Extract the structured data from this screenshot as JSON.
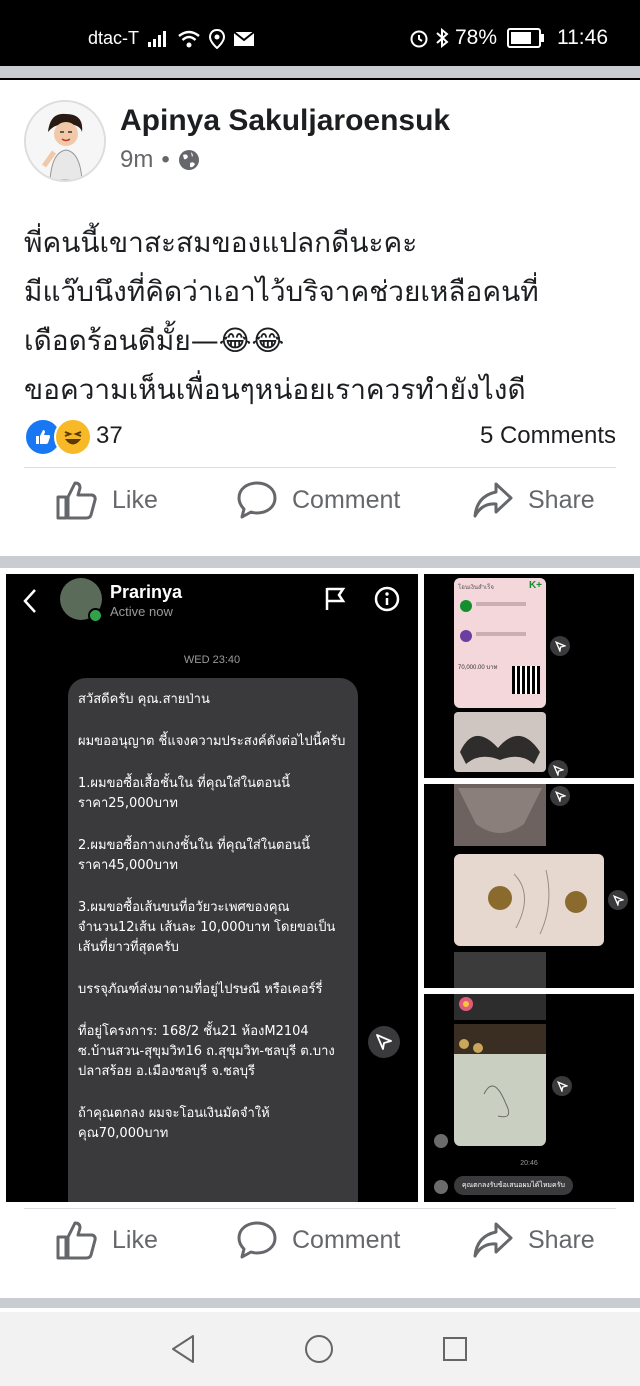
{
  "status_bar": {
    "carrier": "dtac-T",
    "battery": "78%",
    "battery_level": 0.78,
    "time": "11:46"
  },
  "post": {
    "author": "Apinya Sakuljaroensuk",
    "time_ago": "9m",
    "text_lines": [
      "พี่คนนี้เขาสะสมของแปลกดีนะคะ",
      "มีแว๊บนึงที่คิดว่าเอาไว้บริจาคช่วยเหลือคนที่",
      "เดือดร้อนดีมั้ย—😂😂",
      "ขอความเห็นเพื่อนๆหน่อยเราควรทำยังไงดี"
    ],
    "reaction_count": "37",
    "comments": "5 Comments"
  },
  "actions": {
    "like": "Like",
    "comment": "Comment",
    "share": "Share"
  },
  "chat": {
    "contact_name": "Prarinya",
    "contact_status": "Active now",
    "timestamp": "WED 23:40",
    "message_paragraphs": [
      "สวัสดีครับ คุณ.สายป่าน",
      "ผมขออนุญาต ชี้แจงความประสงค์ดังต่อไปนี้ครับ",
      "1.ผมขอซื้อเสื้อชั้นใน ที่คุณใส่ในตอนนี้ ราคา25,000บาท",
      "2.ผมขอซื้อกางเกงชั้นใน ที่คุณใส่ในตอนนี้ ราคา45,000บาท",
      "3.ผมขอซื้อเส้นขนที่อวัยวะเพศของคุณ จำนวน12เส้น เส้นละ 10,000บาท โดยขอเป็นเส้นที่ยาวที่สุดครับ",
      "บรรจุภัณฑ์ส่งมาตามที่อยู่ไปรษณี หรือเคอร์รี่",
      "ที่อยู่โครงการ: 168/2 ชั้น21 ห้องM2104 ซ.บ้านสวน-สุขุมวิท16 ถ.สุขุมวิท-ชลบุรี ต.บางปลาสร้อย อ.เมืองชลบุรี จ.ชลบุรี",
      "ถ้าคุณตกลง ผมจะโอนเงินมัดจำให้คุณ70,000บาท"
    ]
  },
  "thumbnails": {
    "bank_badge": "K+",
    "bank_title": "โอนเงินสำเร็จ",
    "bank_amount": "70,000.00 บาท",
    "small_time": "20:46",
    "small_reply": "คุณตกลงรับข้อเสนอผมได้ไหมครับ"
  },
  "colors": {
    "facebook_blue": "#1877f2",
    "haha_yellow": "#f7b928",
    "separator": "#c9ccd1",
    "secondary_text": "#65676b",
    "bubble_gray": "#3a3a3c"
  },
  "icons": [
    "signal-icon",
    "wifi-icon",
    "location-icon",
    "mail-icon",
    "alarm-icon",
    "bluetooth-icon",
    "globe-icon",
    "like-icon",
    "comment-icon",
    "share-icon",
    "back-icon",
    "flag-icon",
    "info-icon",
    "send-icon",
    "nav-back-icon",
    "nav-home-icon",
    "nav-recents-icon"
  ]
}
